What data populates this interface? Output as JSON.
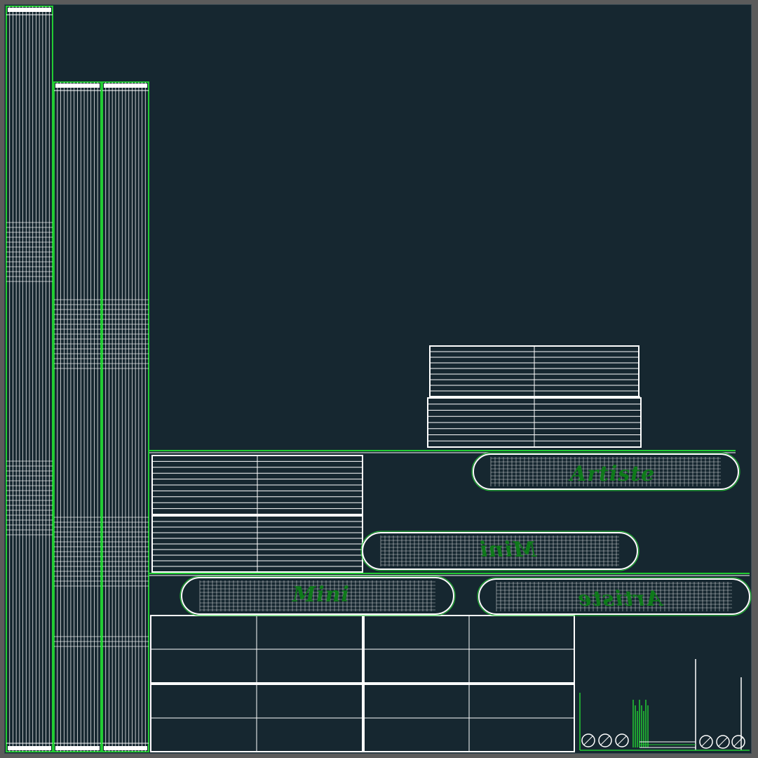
{
  "viewport": {
    "background": "#162730",
    "border_color": "#5b5b5b",
    "wire_color": "#ffffff",
    "edge_color": "#22cc33",
    "text_color": "#0e7a1a"
  },
  "labels": {
    "artiste_top": "Artiste",
    "mini_mirrored": "Mini",
    "mini_bottom": "Mini",
    "artiste_mirrored": "Artiste"
  }
}
